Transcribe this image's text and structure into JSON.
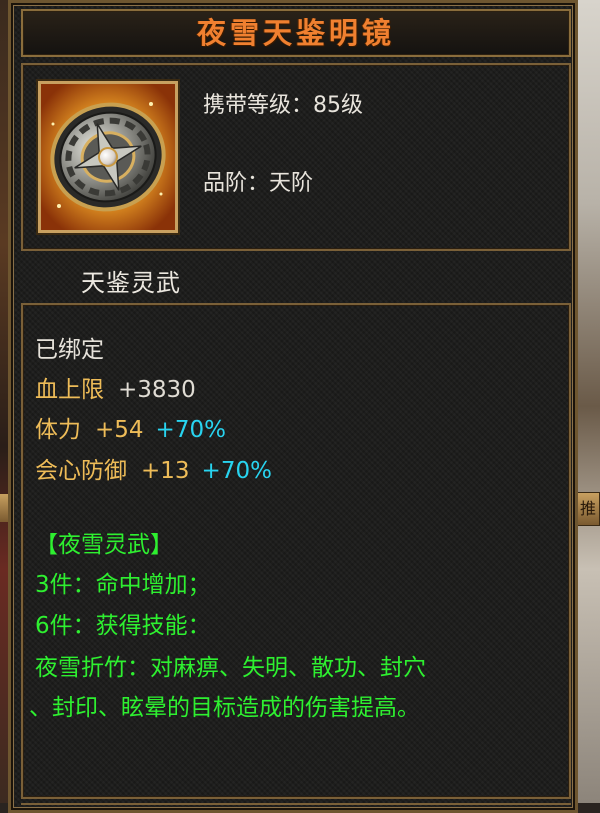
{
  "item": {
    "name": "夜雪天鉴明镜",
    "level_label": "携带等级：",
    "level_value": "85级",
    "grade_label": "品阶：",
    "grade_value": "天阶",
    "set_group": "天鉴灵武",
    "icon": "mirror-shield-icon"
  },
  "status": {
    "bound": "已绑定"
  },
  "attributes": [
    {
      "name": "血上限",
      "value": "+3830",
      "bonus": ""
    },
    {
      "name": "体力",
      "value": "+54",
      "bonus": "+70%"
    },
    {
      "name": "会心防御",
      "value": "+13",
      "bonus": "+70%"
    }
  ],
  "set_bonus": {
    "title": "【夜雪灵武】",
    "piece3": "3件：命中增加；",
    "piece6": "6件：获得技能：",
    "skill_line1": "夜雪折竹：对麻痹、失明、散功、封穴",
    "skill_line2": "、封印、眩晕的目标造成的伤害提高。"
  },
  "side_tab": "推",
  "colors": {
    "title": "#f08030",
    "attr_name": "#eebc58",
    "attr_bonus": "#28d4f0",
    "set_text": "#2ef030",
    "border": "#7a6038"
  }
}
